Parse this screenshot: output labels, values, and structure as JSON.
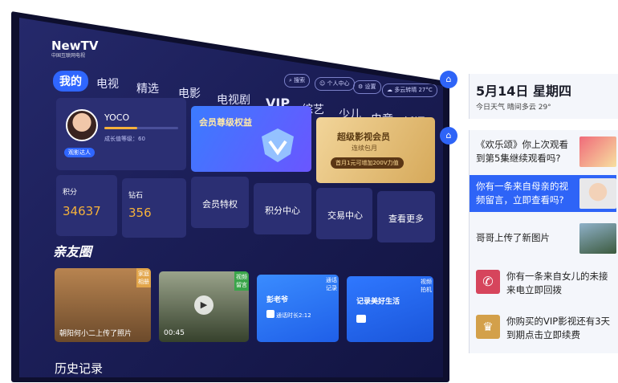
{
  "brand": {
    "logo": "NewTV",
    "logo_sub": "中国互联网电视"
  },
  "tabs": [
    "我的",
    "电视",
    "精选",
    "电影",
    "电视剧",
    "VIP",
    "综艺",
    "少儿",
    "电竞",
    "新闻"
  ],
  "top_pills": [
    "搜索",
    "个人中心",
    "设置",
    "多云转晴 27°C"
  ],
  "profile": {
    "name": "YOCO",
    "level_text": "成长值等级：60",
    "badge": "观影达人"
  },
  "points": {
    "label": "积分",
    "value": "34637"
  },
  "diamonds": {
    "label": "钻石",
    "value": "356"
  },
  "banners": {
    "member": "会员尊级权益",
    "super_title": "超级影视会员",
    "super_sub": "连续包月",
    "super_cta": "首月1元可增加200V力值"
  },
  "quick": [
    "会员特权",
    "积分中心",
    "交易中心",
    "查看更多"
  ],
  "friends_title": "亲友圈",
  "friend_cards": [
    {
      "caption": "朝阳何小二上传了照片",
      "tag": "家庭相册"
    },
    {
      "caption": "00:45",
      "tag": "视频留言"
    },
    {
      "caption": "彭老爷",
      "sub": "通话时长2:12",
      "tag": "通话记录"
    },
    {
      "caption": "记录美好生活",
      "tag": "视频拍机"
    }
  ],
  "history_title": "历史记录",
  "date": {
    "date": "5月14日 星期四",
    "weather": "今日天气  晴间多云 29°"
  },
  "messages": [
    "《欢乐颂》你上次观看到第5集继续观看吗?",
    "你有一条来自母亲的视频留言，立即查看吗?",
    "哥哥上传了新图片",
    "你有一条来自女儿的未接来电立即回拨",
    "你购买的VIP影视还有3天到期点击立即续费"
  ],
  "colors": {
    "accent": "#2e64f7",
    "vip_gold": "#f5b13b"
  }
}
